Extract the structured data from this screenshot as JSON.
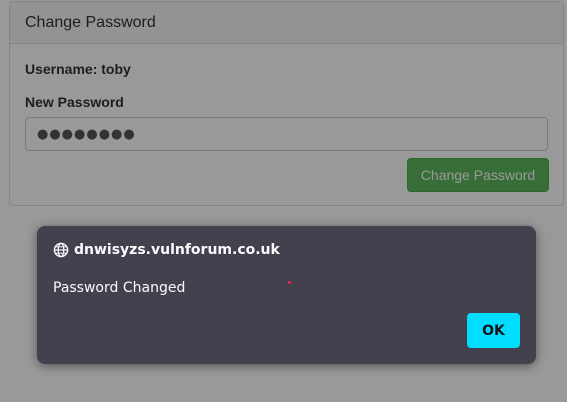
{
  "panel": {
    "title": "Change Password",
    "username_label": "Username: toby",
    "new_password_label": "New Password",
    "password_value": "●●●●●●●●",
    "submit_label": "Change Password"
  },
  "dialog": {
    "origin": "dnwisyzs.vulnforum.co.uk",
    "origin_icon": "globe-icon",
    "message": "Password Changed",
    "ok_label": "OK"
  },
  "colors": {
    "dialog_bg": "#42414d",
    "ok_button": "#00ddff",
    "submit_button": "#5cb85c"
  }
}
